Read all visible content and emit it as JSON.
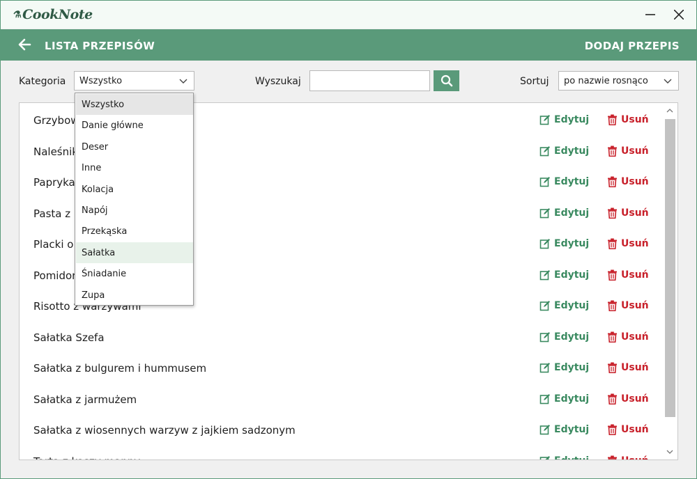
{
  "app": {
    "name": "CookNote",
    "minimize_icon": "minimize-icon",
    "close_icon": "close-icon"
  },
  "header": {
    "back_icon": "arrow-left-icon",
    "title": "LISTA PRZEPISÓW",
    "add_recipe": "DODAJ PRZEPIS"
  },
  "filters": {
    "category_label": "Kategoria",
    "category_value": "Wszystko",
    "search_label": "Wyszukaj",
    "search_value": "",
    "search_icon": "search-icon",
    "sort_label": "Sortuj",
    "sort_value": "po nazwie rosnąco"
  },
  "category_options": [
    "Wszystko",
    "Danie główne",
    "Deser",
    "Inne",
    "Kolacja",
    "Napój",
    "Przekąska",
    "Sałatka",
    "Śniadanie",
    "Zupa"
  ],
  "recipes": {
    "edit_label": "Edytuj",
    "delete_label": "Usuń",
    "items": [
      "Grzybowa",
      "Naleśniki",
      "Papryka",
      "Pasta z",
      "Placki o",
      "Pomidor",
      "Risotto z warzywami",
      "Sałatka Szefa",
      "Sałatka z bulgurem i hummusem",
      "Sałatka z jarmużem",
      "Sałatka z wiosennych warzyw z jajkiem sadzonym",
      "Tarta z kaszy manny"
    ]
  },
  "colors": {
    "accent": "#5a9a7a",
    "edit": "#3a8a60",
    "delete": "#c8202a"
  }
}
